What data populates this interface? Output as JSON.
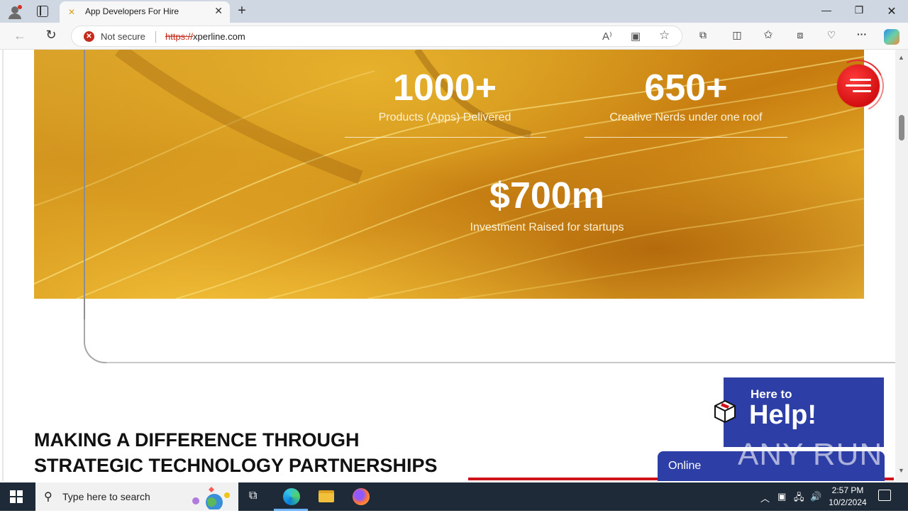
{
  "browser": {
    "tab_title": "App Developers For Hire",
    "security_label": "Not secure",
    "url_scheme": "https://",
    "url_host": "xperline.com"
  },
  "stats": [
    {
      "number": "1000+",
      "caption": "Products (Apps) Delivered"
    },
    {
      "number": "650+",
      "caption": "Creative Nerds under one roof"
    },
    {
      "number": "$700m",
      "caption": "Investment Raised for startups"
    }
  ],
  "headline": {
    "line1": "MAKING A DIFFERENCE THROUGH",
    "line2": "STRATEGIC TECHNOLOGY PARTNERSHIPS"
  },
  "chat_widget": {
    "small": "Here to",
    "big": "Help!",
    "status": "Online"
  },
  "watermark": "ANY RUN",
  "taskbar": {
    "search_placeholder": "Type here to search",
    "time": "2:57 PM",
    "date": "10/2/2024"
  },
  "colors": {
    "menu_red": "#d40f12",
    "widget_blue": "#2d3ea6",
    "accent_red": "#d0121b"
  }
}
